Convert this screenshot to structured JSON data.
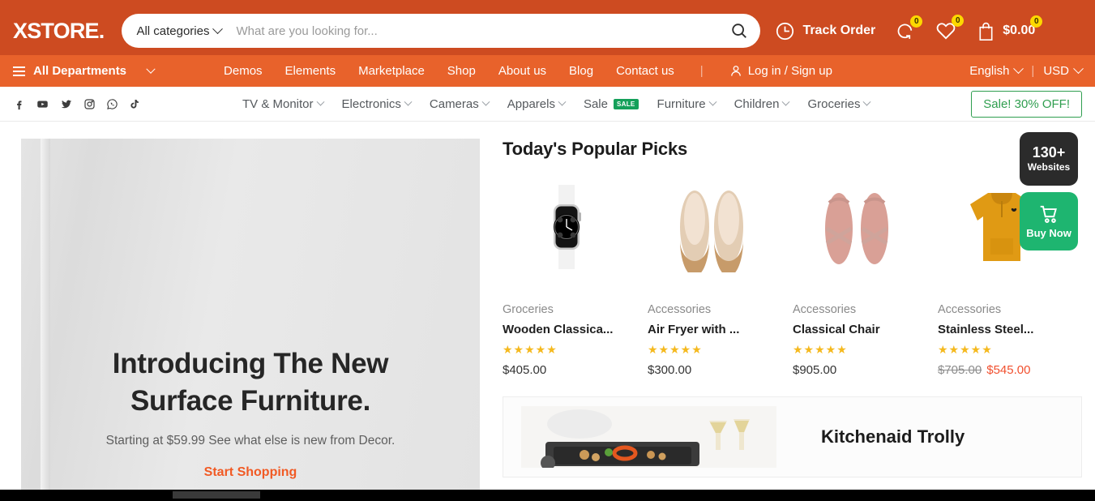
{
  "brand": {
    "logo": "XSTORE."
  },
  "search": {
    "category_label": "All categories",
    "placeholder": "What are you looking for...",
    "value": ""
  },
  "header": {
    "track_order": "Track Order",
    "compare_count": "0",
    "wishlist_count": "0",
    "cart_count": "0",
    "cart_total": "$0.00"
  },
  "mainnav": {
    "departments": "All Departments",
    "links": [
      "Demos",
      "Elements",
      "Marketplace",
      "Shop",
      "About us",
      "Blog",
      "Contact us"
    ],
    "separator": "|",
    "account": "Log in / Sign up",
    "language": "English",
    "currency": "USD"
  },
  "catbar": {
    "socials": [
      "facebook-icon",
      "youtube-icon",
      "twitter-icon",
      "instagram-icon",
      "whatsapp-icon",
      "tiktok-icon"
    ],
    "categories": [
      {
        "label": "TV & Monitor",
        "badge": ""
      },
      {
        "label": "Electronics",
        "badge": ""
      },
      {
        "label": "Cameras",
        "badge": ""
      },
      {
        "label": "Apparels",
        "badge": ""
      },
      {
        "label": "Sale",
        "badge": "SALE"
      },
      {
        "label": "Furniture",
        "badge": ""
      },
      {
        "label": "Children",
        "badge": ""
      },
      {
        "label": "Groceries",
        "badge": ""
      }
    ],
    "cta": "Sale! 30% OFF!"
  },
  "hero": {
    "title_line1": "Introducing The New",
    "title_line2": "Surface Furniture.",
    "subtitle": "Starting at $59.99 See what else is new from Decor.",
    "cta": "Start Shopping"
  },
  "picks": {
    "title": "Today's Popular Picks",
    "products": [
      {
        "category": "Groceries",
        "name": "Wooden Classica...",
        "stars": "★★★★★",
        "price": "$405.00",
        "old_price": "",
        "image": "smartwatch-image"
      },
      {
        "category": "Accessories",
        "name": "Air Fryer with ...",
        "stars": "★★★★★",
        "price": "$300.00",
        "old_price": "",
        "image": "flat-shoes-image"
      },
      {
        "category": "Accessories",
        "name": "Classical Chair",
        "stars": "★★★★★",
        "price": "$905.00",
        "old_price": "",
        "image": "pink-sandals-image"
      },
      {
        "category": "Accessories",
        "name": "Stainless Steel...",
        "stars": "★★★★★",
        "price": "$545.00",
        "old_price": "$705.00",
        "image": "mustard-hoodie-image"
      }
    ]
  },
  "promo_card": {
    "title": "Kitchenaid Trolly"
  },
  "floating": {
    "sites_count": "130+",
    "sites_label": "Websites",
    "buy_label": "Buy Now"
  },
  "colors": {
    "header_orange": "#cd4b21",
    "nav_orange": "#e8622b",
    "accent_orange": "#f15a24",
    "sale_price": "#f1502f",
    "star_gold": "#f5b91e",
    "green": "#2f9e4f",
    "badge_yellow": "#fdd800",
    "buy_green": "#1eb570"
  }
}
